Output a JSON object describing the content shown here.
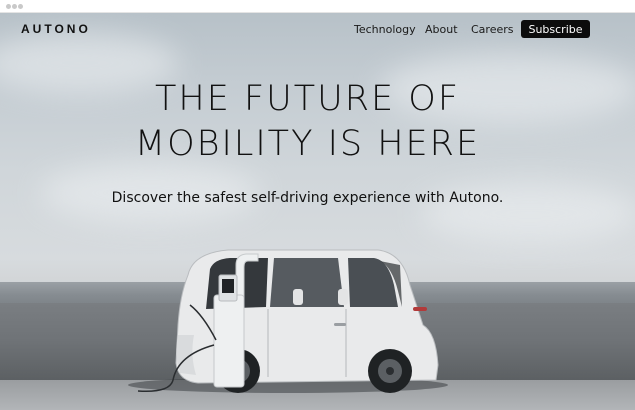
{
  "brand": {
    "name": "AUTONO"
  },
  "nav": {
    "links": [
      "Technology",
      "About",
      "Careers"
    ],
    "subscribe_label": "Subscribe"
  },
  "hero": {
    "title_line1": "THE FUTURE OF",
    "title_line2": "MOBILITY IS HERE",
    "subtitle": "Discover the safest self-driving experience with Autono."
  },
  "colors": {
    "button_bg": "#0c0c0c",
    "text": "#111111",
    "sky": "#c9d0d5"
  },
  "icons": [
    "window-dot-icon",
    "ev-charger-icon"
  ]
}
